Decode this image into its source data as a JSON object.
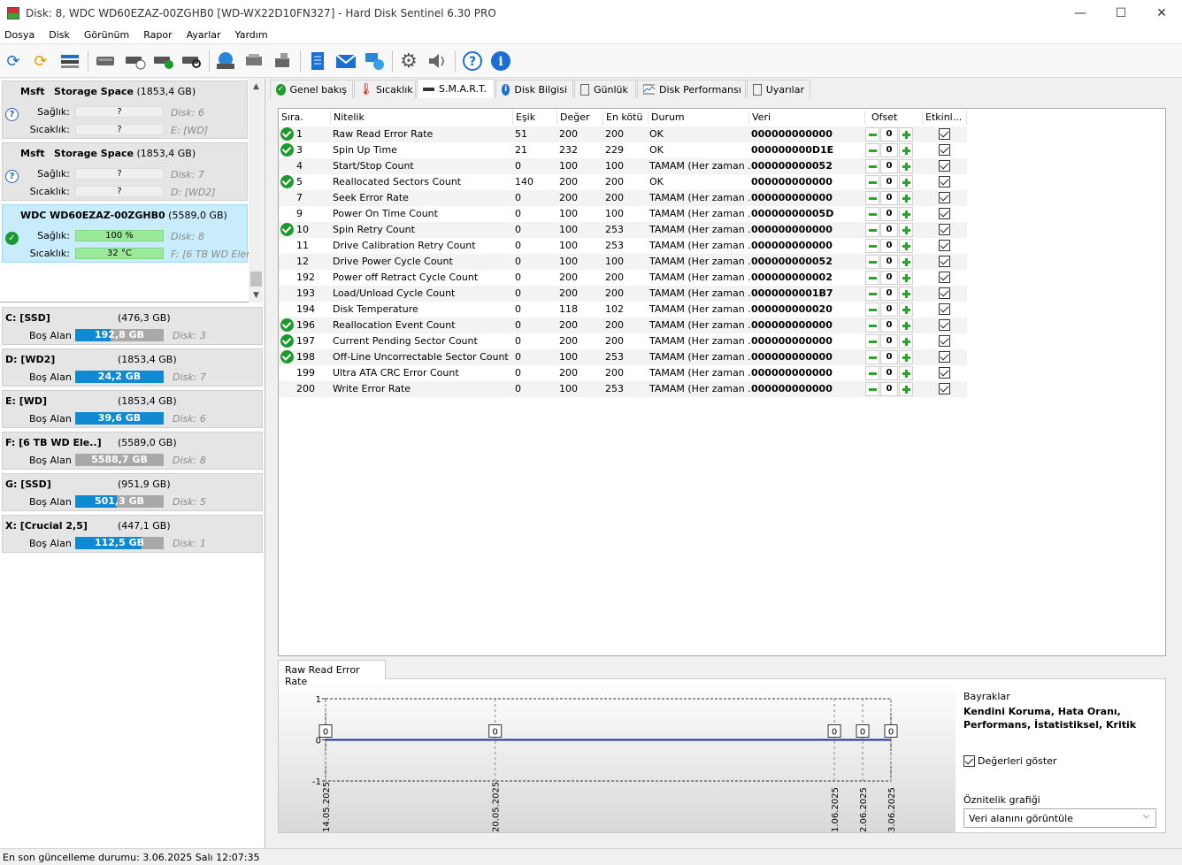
{
  "window": {
    "title": "Disk: 8, WDC WD60EZAZ-00ZGHB0 [WD-WX22D10FN327]  -  Hard Disk Sentinel 6.30 PRO",
    "minimize": "—",
    "maximize": "☐",
    "close": "✕"
  },
  "menu": [
    "Dosya",
    "Disk",
    "Görünüm",
    "Rapor",
    "Ayarlar",
    "Yardım"
  ],
  "toolbar": [
    "refresh-icon",
    "refresh-warning-icon",
    "disk-list-icon",
    "disk-icon",
    "disk-clock-icon",
    "disk-check-icon",
    "disk-search-icon",
    "globe-disk-icon",
    "network-disk-icon",
    "usb-disk-icon",
    "notepad-icon",
    "mail-icon",
    "network-icon",
    "gear-icon",
    "speaker-icon",
    "help-icon",
    "info-icon"
  ],
  "disks": [
    {
      "model": "Msft",
      "name": "Storage Space",
      "size": "(1853,4 GB)",
      "health_label": "Sağlık:",
      "health": "?",
      "health_extra": "Disk: 6",
      "temp_label": "Sıcaklık:",
      "temp": "?",
      "temp_extra": "E: [WD]",
      "status": "unknown"
    },
    {
      "model": "Msft",
      "name": "Storage Space",
      "size": "(1853,4 GB)",
      "health_label": "Sağlık:",
      "health": "?",
      "health_extra": "Disk: 7",
      "temp_label": "Sıcaklık:",
      "temp": "?",
      "temp_extra": "D: [WD2]",
      "status": "unknown"
    },
    {
      "model": "WDC WD60EZAZ-00ZGHB0",
      "name": "",
      "size": "(5589,0 GB)",
      "health_label": "Sağlık:",
      "health": "100 %",
      "health_extra": "Disk: 8",
      "temp_label": "Sıcaklık:",
      "temp": "32 °C",
      "temp_extra": "F: [6 TB WD Elem",
      "status": "ok"
    }
  ],
  "volumes": [
    {
      "name": "C: [SSD]",
      "size": "(476,3 GB)",
      "free_label": "Boş Alan",
      "free": "192,8 GB",
      "fill": 40,
      "disk": "Disk: 3",
      "color": "#0f8ad2"
    },
    {
      "name": "D: [WD2]",
      "size": "(1853,4 GB)",
      "free_label": "Boş Alan",
      "free": "24,2 GB",
      "fill": 100,
      "disk": "Disk: 7",
      "color": "#0f8ad2"
    },
    {
      "name": "E: [WD]",
      "size": "(1853,4 GB)",
      "free_label": "Boş Alan",
      "free": "39,6 GB",
      "fill": 100,
      "disk": "Disk: 6",
      "color": "#0f8ad2"
    },
    {
      "name": "F: [6 TB WD Ele..]",
      "size": "(5589,0 GB)",
      "free_label": "Boş Alan",
      "free": "5588,7 GB",
      "fill": 0,
      "disk": "Disk: 8",
      "color": "#0f8ad2"
    },
    {
      "name": "G: [SSD]",
      "size": "(951,9 GB)",
      "free_label": "Boş Alan",
      "free": "501,3 GB",
      "fill": 47,
      "disk": "Disk: 5",
      "color": "#0f8ad2"
    },
    {
      "name": "X: [Crucial 2,5]",
      "size": "(447,1 GB)",
      "free_label": "Boş Alan",
      "free": "112,5 GB",
      "fill": 75,
      "disk": "Disk: 1",
      "color": "#0f8ad2"
    }
  ],
  "tabs": [
    {
      "label": "Genel bakış",
      "icon": "check-icon"
    },
    {
      "label": "Sıcaklık",
      "icon": "thermometer-icon"
    },
    {
      "label": "S.M.A.R.T.",
      "icon": "disk-icon"
    },
    {
      "label": "Disk Bilgisi",
      "icon": "info-icon"
    },
    {
      "label": "Günlük",
      "icon": "document-icon"
    },
    {
      "label": "Disk Performansı",
      "icon": "performance-icon"
    },
    {
      "label": "Uyarılar",
      "icon": "alerts-icon"
    }
  ],
  "smart": {
    "headers": [
      "Sıra.",
      "Nitelik",
      "Eşik",
      "Değer",
      "En kötü",
      "Durum",
      "Veri",
      "Ofset",
      "Etkinl..."
    ],
    "rows": [
      {
        "id": "1",
        "name": "Raw Read Error Rate",
        "thr": "51",
        "val": "200",
        "worst": "200",
        "status": "OK",
        "data": "000000000000",
        "ofs": "0",
        "ok": true
      },
      {
        "id": "3",
        "name": "Spin Up Time",
        "thr": "21",
        "val": "232",
        "worst": "229",
        "status": "OK",
        "data": "000000000D1E",
        "ofs": "0",
        "ok": true
      },
      {
        "id": "4",
        "name": "Start/Stop Count",
        "thr": "0",
        "val": "100",
        "worst": "100",
        "status": "TAMAM (Her zaman ...",
        "data": "000000000052",
        "ofs": "0",
        "ok": false
      },
      {
        "id": "5",
        "name": "Reallocated Sectors Count",
        "thr": "140",
        "val": "200",
        "worst": "200",
        "status": "OK",
        "data": "000000000000",
        "ofs": "0",
        "ok": true
      },
      {
        "id": "7",
        "name": "Seek Error Rate",
        "thr": "0",
        "val": "200",
        "worst": "200",
        "status": "TAMAM (Her zaman ...",
        "data": "000000000000",
        "ofs": "0",
        "ok": false
      },
      {
        "id": "9",
        "name": "Power On Time Count",
        "thr": "0",
        "val": "100",
        "worst": "100",
        "status": "TAMAM (Her zaman ...",
        "data": "00000000005D",
        "ofs": "0",
        "ok": false
      },
      {
        "id": "10",
        "name": "Spin Retry Count",
        "thr": "0",
        "val": "100",
        "worst": "253",
        "status": "TAMAM (Her zaman ...",
        "data": "000000000000",
        "ofs": "0",
        "ok": true
      },
      {
        "id": "11",
        "name": "Drive Calibration Retry Count",
        "thr": "0",
        "val": "100",
        "worst": "253",
        "status": "TAMAM (Her zaman ...",
        "data": "000000000000",
        "ofs": "0",
        "ok": false
      },
      {
        "id": "12",
        "name": "Drive Power Cycle Count",
        "thr": "0",
        "val": "100",
        "worst": "100",
        "status": "TAMAM (Her zaman ...",
        "data": "000000000052",
        "ofs": "0",
        "ok": false
      },
      {
        "id": "192",
        "name": "Power off Retract Cycle Count",
        "thr": "0",
        "val": "200",
        "worst": "200",
        "status": "TAMAM (Her zaman ...",
        "data": "000000000002",
        "ofs": "0",
        "ok": false
      },
      {
        "id": "193",
        "name": "Load/Unload Cycle Count",
        "thr": "0",
        "val": "200",
        "worst": "200",
        "status": "TAMAM (Her zaman ...",
        "data": "0000000001B7",
        "ofs": "0",
        "ok": false
      },
      {
        "id": "194",
        "name": "Disk Temperature",
        "thr": "0",
        "val": "118",
        "worst": "102",
        "status": "TAMAM (Her zaman ...",
        "data": "000000000020",
        "ofs": "0",
        "ok": false
      },
      {
        "id": "196",
        "name": "Reallocation Event Count",
        "thr": "0",
        "val": "200",
        "worst": "200",
        "status": "TAMAM (Her zaman ...",
        "data": "000000000000",
        "ofs": "0",
        "ok": true
      },
      {
        "id": "197",
        "name": "Current Pending Sector Count",
        "thr": "0",
        "val": "200",
        "worst": "200",
        "status": "TAMAM (Her zaman ...",
        "data": "000000000000",
        "ofs": "0",
        "ok": true
      },
      {
        "id": "198",
        "name": "Off-Line Uncorrectable Sector Count",
        "thr": "0",
        "val": "100",
        "worst": "253",
        "status": "TAMAM (Her zaman ...",
        "data": "000000000000",
        "ofs": "0",
        "ok": true
      },
      {
        "id": "199",
        "name": "Ultra ATA CRC Error Count",
        "thr": "0",
        "val": "200",
        "worst": "200",
        "status": "TAMAM (Her zaman ...",
        "data": "000000000000",
        "ofs": "0",
        "ok": false
      },
      {
        "id": "200",
        "name": "Write Error Rate",
        "thr": "0",
        "val": "100",
        "worst": "253",
        "status": "TAMAM (Her zaman ...",
        "data": "000000000000",
        "ofs": "0",
        "ok": false
      }
    ]
  },
  "bottom": {
    "tab": "Raw Read Error Rate",
    "flags_label": "Bayraklar",
    "flags": "Kendini Koruma, Hata Oranı, Performans, İstatistiksel, Kritik",
    "show_values": "Değerleri göster",
    "graph_label": "Öznitelik grafiği",
    "graph_select": "Veri alanını görüntüle"
  },
  "chart_data": {
    "type": "line",
    "x": [
      "14.05.2025",
      "20.05.2025",
      "1.06.2025",
      "2.06.2025",
      "3.06.2025"
    ],
    "x_days": [
      0,
      6,
      18,
      19,
      20
    ],
    "values": [
      0,
      0,
      0,
      0,
      0
    ],
    "value_labels": [
      "0",
      "0",
      "0",
      "0",
      "0"
    ],
    "ylim": [
      -1,
      1
    ],
    "yticks": [
      "1",
      "0",
      "-1"
    ],
    "line_color": "#1c2fa8"
  },
  "status": {
    "text": "En son güncelleme durumu: 3.06.2025 Salı 12:07:35"
  }
}
